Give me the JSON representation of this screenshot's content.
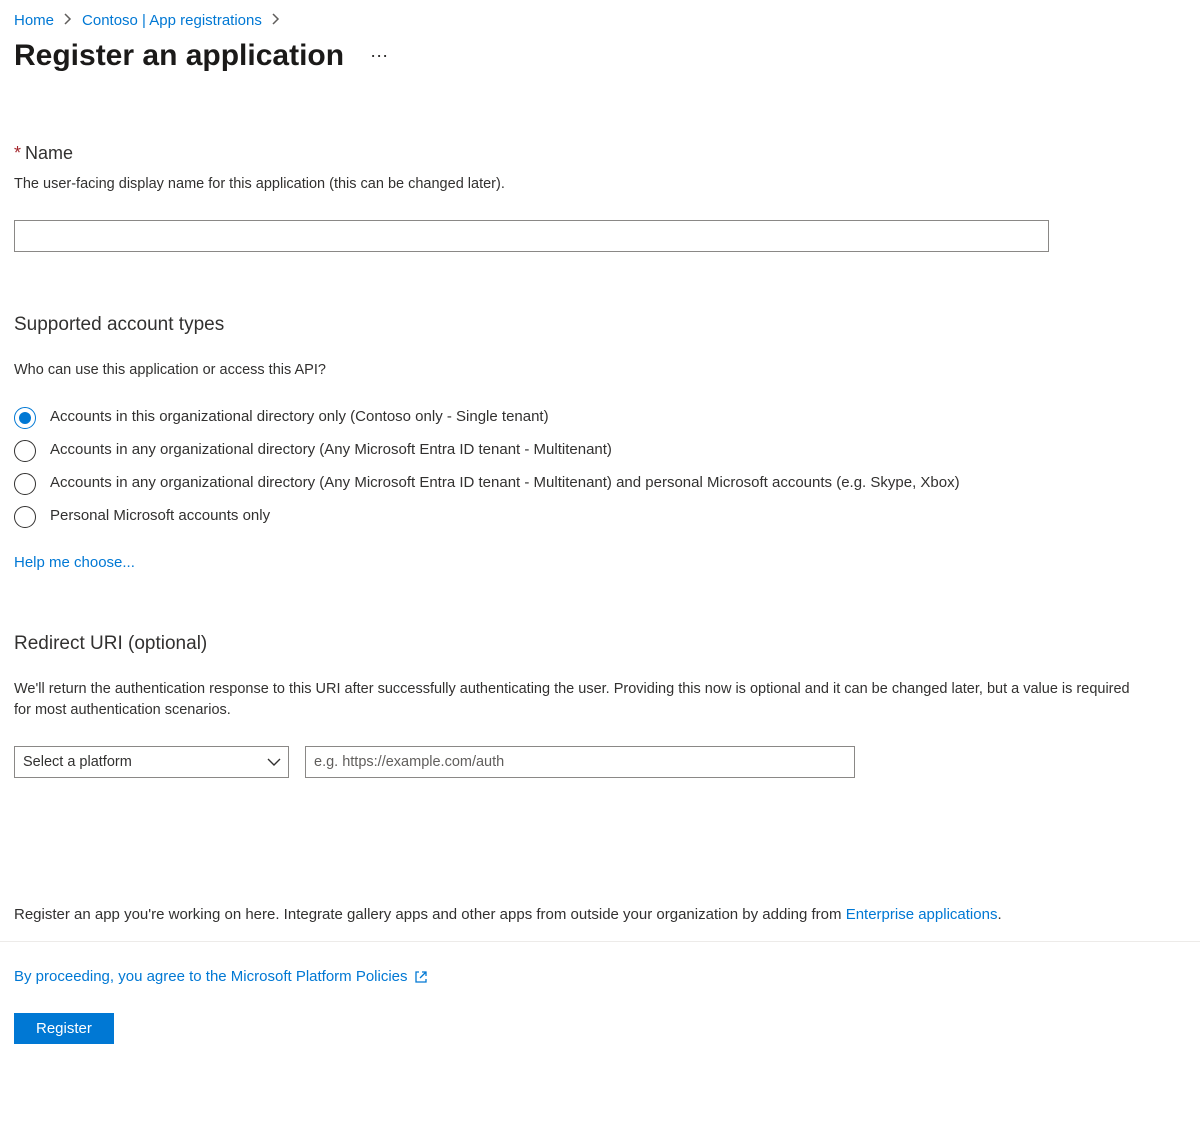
{
  "breadcrumb": {
    "home": "Home",
    "app_registrations": "Contoso | App registrations"
  },
  "page": {
    "title": "Register an application"
  },
  "name_section": {
    "label": "Name",
    "description": "The user-facing display name for this application (this can be changed later).",
    "value": ""
  },
  "account_types": {
    "title": "Supported account types",
    "question": "Who can use this application or access this API?",
    "options": [
      {
        "label": "Accounts in this organizational directory only (Contoso only - Single tenant)",
        "checked": true
      },
      {
        "label": "Accounts in any organizational directory (Any Microsoft Entra ID tenant - Multitenant)",
        "checked": false
      },
      {
        "label": "Accounts in any organizational directory (Any Microsoft Entra ID tenant - Multitenant) and personal Microsoft accounts (e.g. Skype, Xbox)",
        "checked": false
      },
      {
        "label": "Personal Microsoft accounts only",
        "checked": false
      }
    ],
    "help_link": "Help me choose..."
  },
  "redirect": {
    "title": "Redirect URI (optional)",
    "description": "We'll return the authentication response to this URI after successfully authenticating the user. Providing this now is optional and it can be changed later, but a value is required for most authentication scenarios.",
    "platform_placeholder": "Select a platform",
    "uri_placeholder": "e.g. https://example.com/auth"
  },
  "footer": {
    "note_prefix": "Register an app you're working on here. Integrate gallery apps and other apps from outside your organization by adding from ",
    "enterprise_link": "Enterprise applications",
    "note_suffix": ".",
    "policies": "By proceeding, you agree to the Microsoft Platform Policies",
    "register_button": "Register"
  }
}
